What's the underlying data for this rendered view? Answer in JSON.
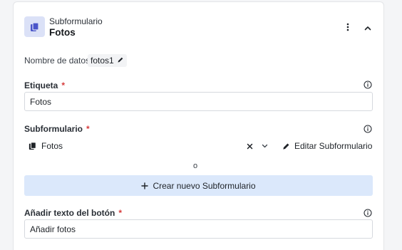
{
  "header": {
    "type_label": "Subformulario",
    "title": "Fotos"
  },
  "data_name": {
    "label": "Nombre de datos:",
    "value": "fotos1"
  },
  "label_field": {
    "label": "Etiqueta",
    "required_mark": "*",
    "value": "Fotos"
  },
  "subform_field": {
    "label": "Subformulario",
    "required_mark": "*",
    "selected": "Fotos",
    "edit_label": "Editar Subformulario",
    "or_text": "o",
    "create_label": "Crear nuevo Subformulario"
  },
  "button_text_field": {
    "label": "Añadir texto del botón",
    "required_mark": "*",
    "value": "Añadir fotos"
  },
  "colors": {
    "accent_icon": "#4a55c9",
    "icon_bg": "#dbe1f7",
    "create_bg": "#dbe8fb",
    "required": "#d63b3b"
  }
}
